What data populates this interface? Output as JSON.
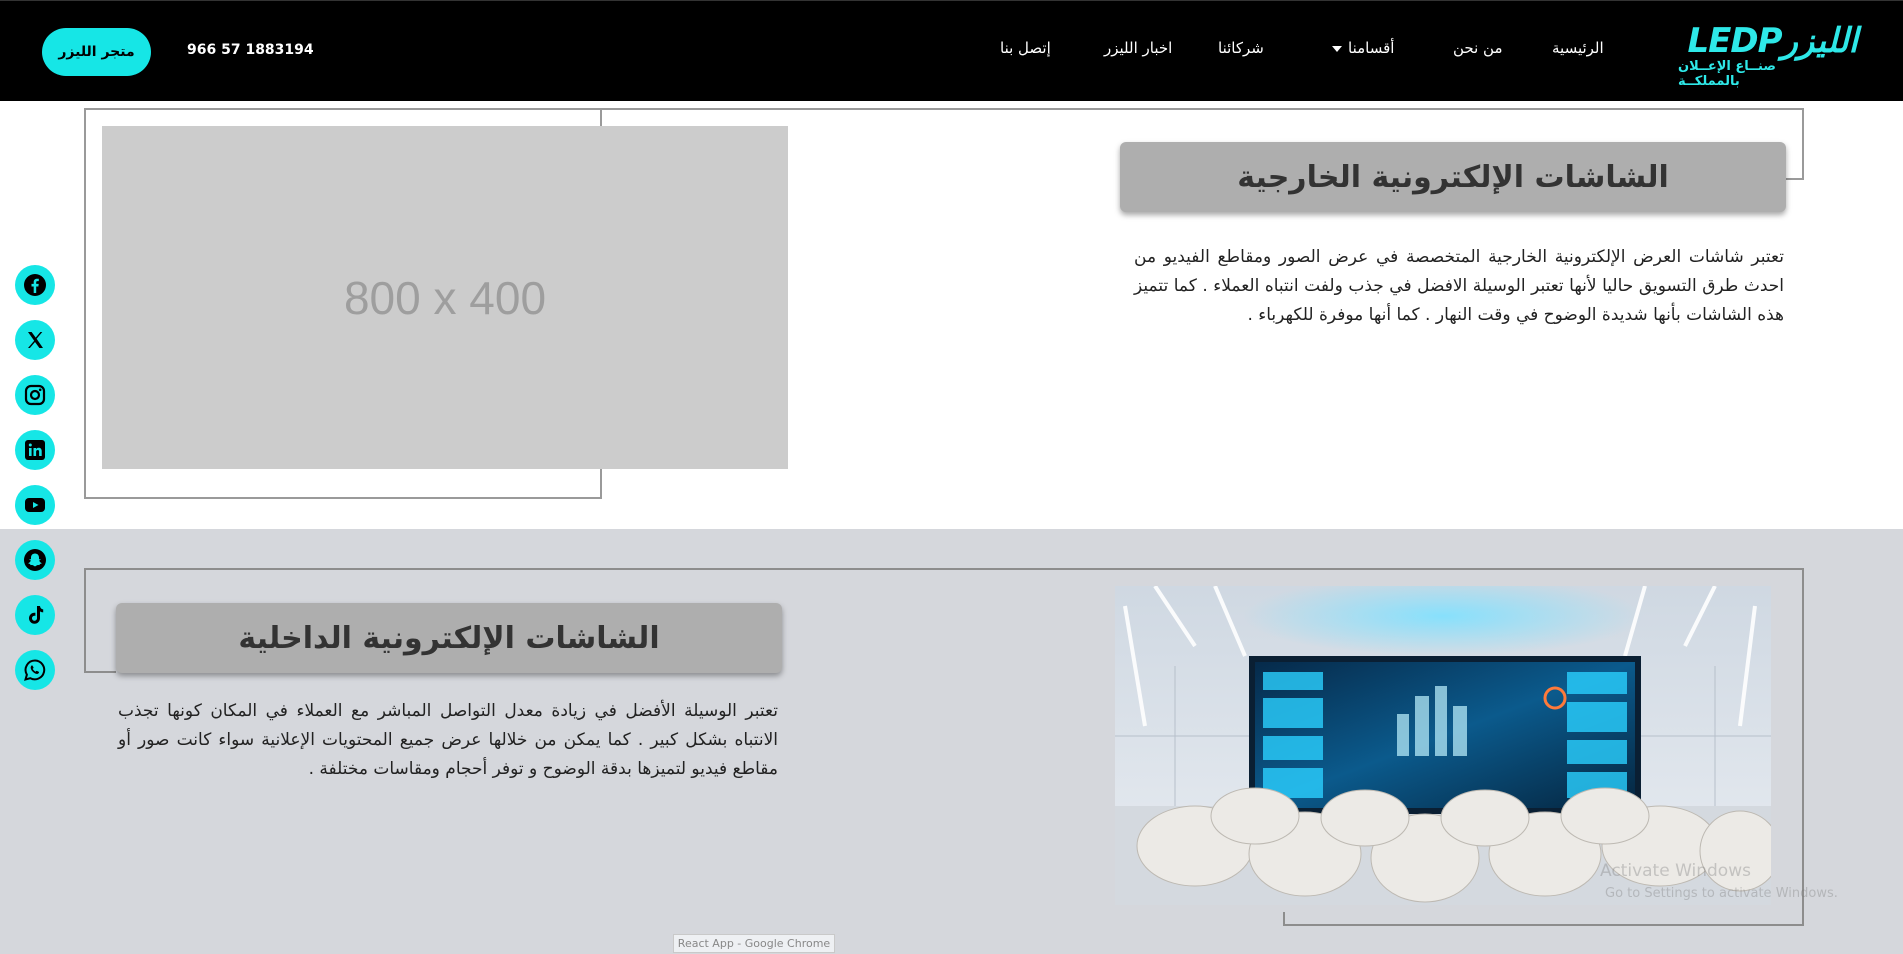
{
  "header": {
    "logo_text": "LEDPالليزر",
    "logo_tagline": "صنــاع الإعــلان بالمملكــة",
    "nav": [
      "الرئيسية",
      "من نحن",
      "أقسامنا",
      "شركائنا",
      "اخبار الليزر",
      "إتصل بنا"
    ],
    "phone": "966 57 1883194",
    "store_label": "متجر الليزر"
  },
  "section_outdoor": {
    "title": "الشاشات الإلكترونية الخارجية",
    "text": "تعتبر شاشات العرض الإلكترونية الخارجية المتخصصة في عرض الصور ومقاطع الفيديو من احدث طرق التسويق حاليا لأنها تعتبر الوسيلة الافضل في جذب ولفت انتباه العملاء . كما تتميز هذه الشاشات بأنها شديدة الوضوح في وقت النهار . كما أنها موفرة للكهرباء .",
    "image_placeholder": "800 x 400"
  },
  "section_indoor": {
    "title": "الشاشات الإلكترونية الداخلية",
    "text": "تعتبر الوسيلة الأفضل في زيادة معدل التواصل المباشر مع العملاء في المكان كونها تجذب الانتباه بشكل كبير . كما يمكن من خلالها عرض جميع المحتويات الإعلانية سواء كانت صور أو مقاطع فيديو لتميزها بدقة الوضوح و توفر أحجام ومقاسات مختلفة ."
  },
  "social_icons": [
    "facebook-icon",
    "x-icon",
    "instagram-icon",
    "linkedin-icon",
    "youtube-icon",
    "snapchat-icon",
    "tiktok-icon",
    "whatsapp-icon"
  ],
  "overlays": {
    "activate_title": "Activate Windows",
    "activate_sub": "Go to Settings to activate Windows.",
    "taskbar_tooltip": "React App - Google Chrome"
  },
  "colors": {
    "accent": "#16e6e6",
    "header_bg": "#000000",
    "section2_bg": "#d5d7dc",
    "title_box": "#aeaeae"
  }
}
